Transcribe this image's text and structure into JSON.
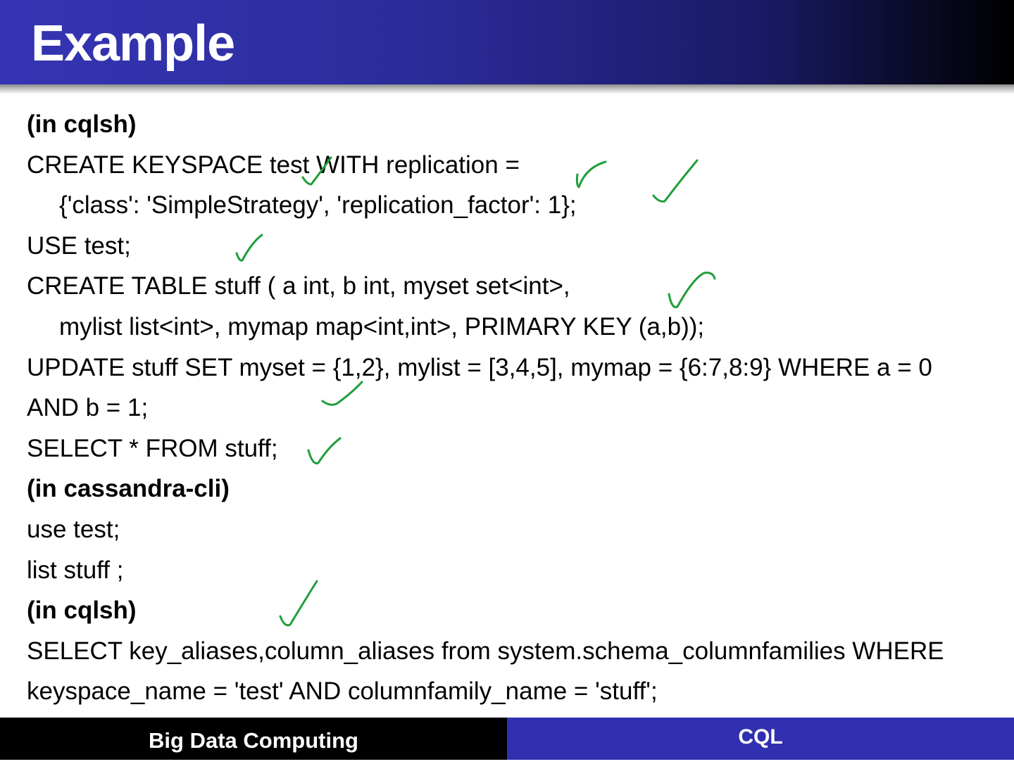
{
  "header": {
    "title": "Example"
  },
  "content": {
    "lines": [
      "(in cqlsh)",
      "CREATE KEYSPACE test WITH replication =",
      "{'class': 'SimpleStrategy', 'replication_factor': 1};",
      "USE test;",
      "CREATE TABLE stuff ( a int, b int, myset set<int>,",
      "mylist list<int>, mymap map<int,int>, PRIMARY KEY (a,b));",
      "UPDATE stuff SET myset = {1,2}, mylist = [3,4,5], mymap = {6:7,8:9} WHERE a = 0",
      "AND b = 1;",
      "SELECT * FROM stuff;",
      "(in cassandra-cli)",
      "use test;",
      "list stuff ;",
      "(in cqlsh)",
      "SELECT key_aliases,column_aliases from system.schema_columnfamilies WHERE",
      "keyspace_name = 'test' AND columnfamily_name = 'stuff';"
    ]
  },
  "footer": {
    "left_label": "Big Data Computing",
    "right_label": "CQL"
  },
  "colors": {
    "header_blue": "#3535b4",
    "footer_blue": "#3030b0",
    "annotation_green": "#1f9e3a"
  }
}
